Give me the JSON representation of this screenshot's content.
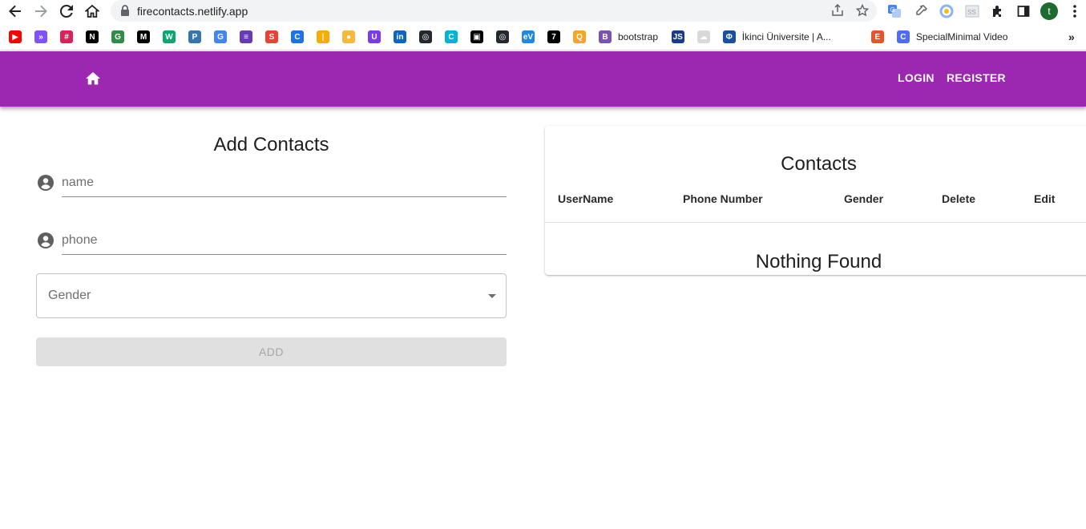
{
  "browser": {
    "url": "firecontacts.netlify.app",
    "profile_initial": "t"
  },
  "bookmarks": [
    {
      "name": "youtube",
      "label": "",
      "color": "#ff0000",
      "glyph": "▶"
    },
    {
      "name": "kotlin",
      "label": "",
      "color": "#7f52ff",
      "glyph": "»"
    },
    {
      "name": "slack",
      "label": "",
      "color": "#e01e5a",
      "glyph": "#"
    },
    {
      "name": "notion",
      "label": "",
      "color": "#000000",
      "glyph": "N"
    },
    {
      "name": "geeksforgeeks",
      "label": "",
      "color": "#2f8d46",
      "glyph": "G"
    },
    {
      "name": "medium",
      "label": "",
      "color": "#000000",
      "glyph": "M"
    },
    {
      "name": "w3schools",
      "label": "",
      "color": "#04aa6d",
      "glyph": "W"
    },
    {
      "name": "python",
      "label": "",
      "color": "#3776ab",
      "glyph": "P"
    },
    {
      "name": "google",
      "label": "",
      "color": "#4285f4",
      "glyph": "G"
    },
    {
      "name": "list",
      "label": "",
      "color": "#673ab7",
      "glyph": "≡"
    },
    {
      "name": "swirl",
      "label": "",
      "color": "#ea4335",
      "glyph": "S"
    },
    {
      "name": "c-blue",
      "label": "",
      "color": "#1a73e8",
      "glyph": "C"
    },
    {
      "name": "bars",
      "label": "",
      "color": "#f9ab00",
      "glyph": "|"
    },
    {
      "name": "dot",
      "label": "",
      "color": "#f6b93b",
      "glyph": "●"
    },
    {
      "name": "u-purple",
      "label": "",
      "color": "#7c3aed",
      "glyph": "U"
    },
    {
      "name": "linkedin",
      "label": "",
      "color": "#0a66c2",
      "glyph": "in"
    },
    {
      "name": "github-1",
      "label": "",
      "color": "#24292f",
      "glyph": "◎"
    },
    {
      "name": "c-cyan",
      "label": "",
      "color": "#00b4d8",
      "glyph": "C"
    },
    {
      "name": "window",
      "label": "",
      "color": "#000000",
      "glyph": "▣"
    },
    {
      "name": "github-2",
      "label": "",
      "color": "#24292f",
      "glyph": "◎"
    },
    {
      "name": "ev",
      "label": "",
      "color": "#1e88e5",
      "glyph": "eV"
    },
    {
      "name": "seven",
      "label": "",
      "color": "#000000",
      "glyph": "7"
    },
    {
      "name": "q",
      "label": "",
      "color": "#f5a623",
      "glyph": "Q"
    },
    {
      "name": "bootstrap",
      "label": "bootstrap",
      "color": "#7952b3",
      "glyph": "B"
    },
    {
      "name": "js",
      "label": "",
      "color": "#1a3a8a",
      "glyph": "JS"
    },
    {
      "name": "cloud",
      "label": "",
      "color": "#d9d9d9",
      "glyph": "☁"
    },
    {
      "name": "ikinci",
      "label": "İkinci Üniversite | A...",
      "color": "#1a4fa0",
      "glyph": "Φ"
    },
    {
      "name": "e-orange",
      "label": "",
      "color": "#e8542a",
      "glyph": "E"
    },
    {
      "name": "specialminimal",
      "label": "SpecialMinimal Video",
      "color": "#4f6cf7",
      "glyph": "C"
    }
  ],
  "appbar": {
    "color": "#9c27b0",
    "login_label": "LOGIN",
    "register_label": "REGISTER"
  },
  "form": {
    "title": "Add Contacts",
    "name_placeholder": "name",
    "phone_placeholder": "phone",
    "gender_label": "Gender",
    "add_label": "ADD"
  },
  "contacts": {
    "title": "Contacts",
    "columns": [
      "UserName",
      "Phone Number",
      "Gender",
      "Delete",
      "Edit"
    ],
    "empty_text": "Nothing Found"
  }
}
